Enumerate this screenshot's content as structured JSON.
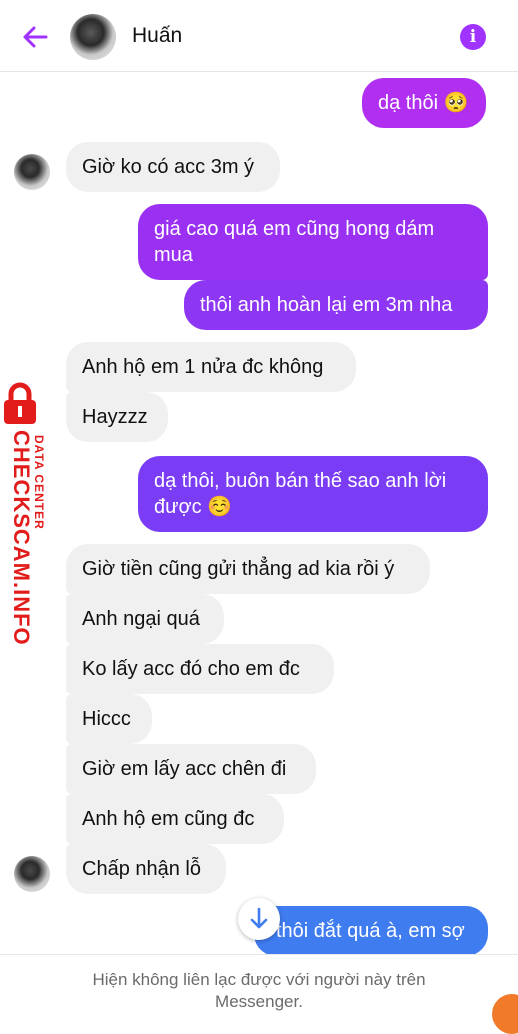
{
  "header": {
    "contact_name": "Huấn",
    "back_icon": "arrow-left-icon",
    "info_icon": "info-icon",
    "info_glyph": "i",
    "accent": "#a033ff"
  },
  "messages": [
    {
      "dir": "out",
      "text": "dạ thôi 🥺"
    },
    {
      "dir": "in",
      "text": "Giờ ko có acc 3m ý"
    },
    {
      "dir": "out",
      "text": "giá cao quá em cũng hong dám mua"
    },
    {
      "dir": "out",
      "text": "thôi anh hoàn lại em 3m nha"
    },
    {
      "dir": "in",
      "text": "Anh hộ em 1 nửa đc không"
    },
    {
      "dir": "in",
      "text": "Hayzzz"
    },
    {
      "dir": "out",
      "text": "dạ thôi, buôn bán thế sao anh lời được ☺️"
    },
    {
      "dir": "in",
      "text": "Giờ tiền cũng gửi thẳng ad kia rồi ý"
    },
    {
      "dir": "in",
      "text": "Anh ngại quá"
    },
    {
      "dir": "in",
      "text": "Ko lấy acc đó cho em đc"
    },
    {
      "dir": "in",
      "text": "Hiccc"
    },
    {
      "dir": "in",
      "text": "Giờ em lấy acc chên đi"
    },
    {
      "dir": "in",
      "text": "Anh hộ em cũng đc"
    },
    {
      "dir": "in",
      "text": "Chấp nhận lỗ"
    },
    {
      "dir": "out",
      "text": "thôi đắt quá à, em sợ"
    }
  ],
  "footer": {
    "notice": "Hiện không liên lạc được với người này trên Messenger."
  },
  "watermark": {
    "main": "CHECKSCAM.INFO",
    "sub": "DATA CENTER"
  },
  "colors": {
    "out_top": "#b02ff0",
    "out_mid": "#7a3df5",
    "out_bottom": "#3f7cf0",
    "in_bg": "#f0f0f0"
  }
}
